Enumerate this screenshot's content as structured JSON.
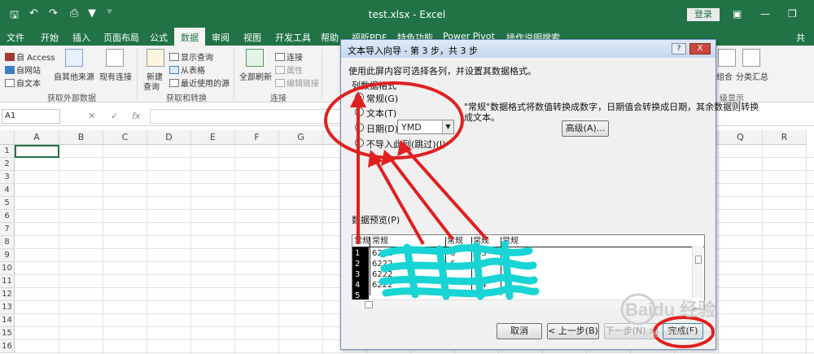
{
  "titlebar": {
    "title": "test.xlsx  -  Excel",
    "login": "登录",
    "qa_icons": [
      "save-icon",
      "undo-icon",
      "redo-icon",
      "print-preview-icon",
      "filter-icon",
      "customize-icon"
    ]
  },
  "tabs": [
    {
      "label": "文件"
    },
    {
      "label": "开始"
    },
    {
      "label": "插入"
    },
    {
      "label": "页面布局"
    },
    {
      "label": "公式"
    },
    {
      "label": "数据",
      "active": true
    },
    {
      "label": "审阅"
    },
    {
      "label": "视图"
    },
    {
      "label": "开发工具"
    },
    {
      "label": "帮助"
    },
    {
      "label": "福昕PDF"
    },
    {
      "label": "特色功能"
    },
    {
      "label": "Power Pivot"
    },
    {
      "label": "操作说明搜索"
    },
    {
      "label": "共"
    }
  ],
  "ribbon": {
    "get_external": {
      "access": "自 Access",
      "web": "自网站",
      "text": "自文本",
      "other": "自其他来源",
      "existing": "现有连接",
      "group": "获取外部数据"
    },
    "get_transform": {
      "new_query_1": "新建",
      "new_query_2": "查询",
      "show_query": "显示查询",
      "from_table": "从表格",
      "recent": "最近使用的源",
      "group": "获取和转换"
    },
    "connections": {
      "refresh_all": "全部刷新",
      "connections": "连接",
      "properties": "属性",
      "edit_links": "编辑链接",
      "group": "连接"
    },
    "outline": {
      "group_cmd": "组合",
      "subtotal": "分类汇总",
      "group": "级显示"
    }
  },
  "formula_bar": {
    "name_box": "A1",
    "fx": "fx"
  },
  "grid": {
    "columns": [
      "A",
      "B",
      "C",
      "D",
      "E",
      "F",
      "G",
      "H",
      "I",
      "J",
      "K",
      "L",
      "M",
      "N",
      "O",
      "P",
      "Q",
      "R"
    ],
    "rows": [
      "1",
      "2",
      "3",
      "4",
      "5",
      "6",
      "7",
      "8",
      "9",
      "10",
      "11",
      "12",
      "13",
      "14",
      "15",
      "16"
    ]
  },
  "dialog": {
    "title": "文本导入向导 - 第 3 步，共 3 步",
    "help": "?",
    "close": "X",
    "instruction": "使用此屏内容可选择各列，并设置其数据格式。",
    "format_group": "列数据格式",
    "opt_general": "常规(G)",
    "opt_text": "文本(T)",
    "opt_date": "日期(D):",
    "opt_skip": "不导入此列(跳过)(I)",
    "date_value": "YMD",
    "desc_line1": "\"常规\"数据格式将数值转换成数字，日期值会转换成日期，其余数据则转换",
    "desc_line2": "成文本。",
    "advanced": "高级(A)...",
    "preview_label": "数据预览(P)",
    "preview_headers": [
      "常规",
      "常规",
      "常规",
      "常规",
      "常规"
    ],
    "preview_rows": [
      [
        "1",
        "6222",
        "6",
        "63",
        "60"
      ],
      [
        "2",
        "6222",
        "6",
        "5",
        "0"
      ],
      [
        "3",
        "6222",
        "",
        "",
        ""
      ],
      [
        "4",
        "6222",
        "",
        "14",
        ""
      ],
      [
        "5",
        "",
        "",
        "37",
        ""
      ]
    ],
    "buttons": {
      "cancel": "取消",
      "back": "< 上一步(B)",
      "next": "下一步(N) >",
      "finish": "完成(F)"
    }
  },
  "watermark": {
    "text": "Baidu 经验",
    "url": "jingyan.baidu.com"
  },
  "colors": {
    "excel_green": "#217346",
    "annotation_red": "#e02020",
    "scribble_cyan": "#19d4d4"
  }
}
